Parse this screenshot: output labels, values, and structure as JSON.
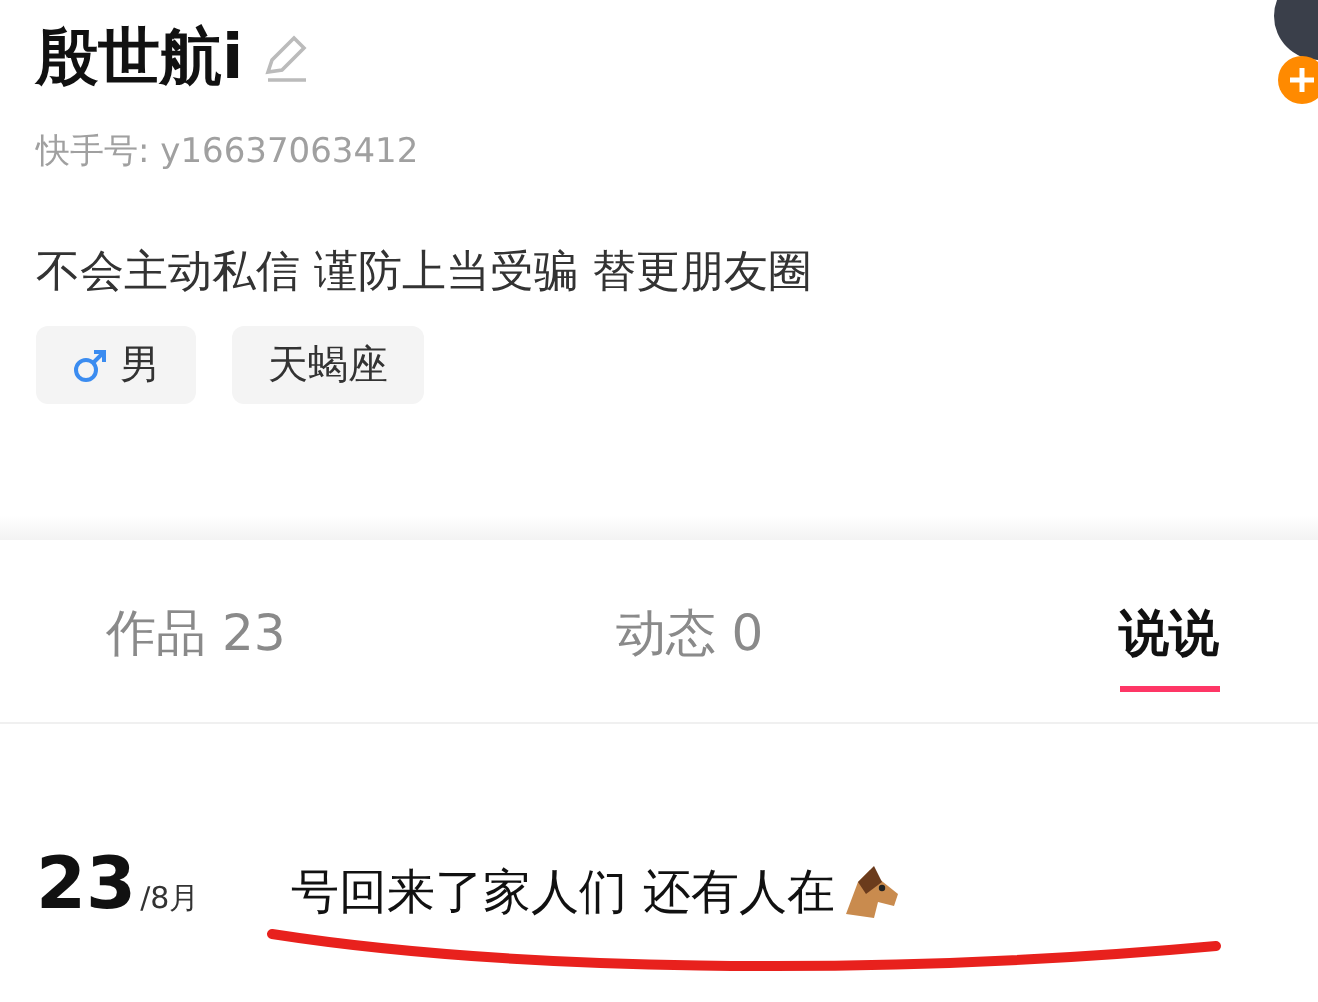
{
  "profile": {
    "name": "殷世航i",
    "account_id": "快手号: y16637063412",
    "bio": "不会主动私信 谨防上当受骗  替更朋友圈",
    "tags": [
      {
        "kind": "gender",
        "label": "男"
      },
      {
        "kind": "plain",
        "label": "天蝎座"
      }
    ]
  },
  "tabs": [
    {
      "label": "作品 23",
      "selected": false
    },
    {
      "label": "动态 0",
      "selected": false
    },
    {
      "label": "说说",
      "selected": true
    }
  ],
  "post": {
    "day": "23",
    "month": "/8月",
    "text": "号回来了家人们 还有人在"
  }
}
